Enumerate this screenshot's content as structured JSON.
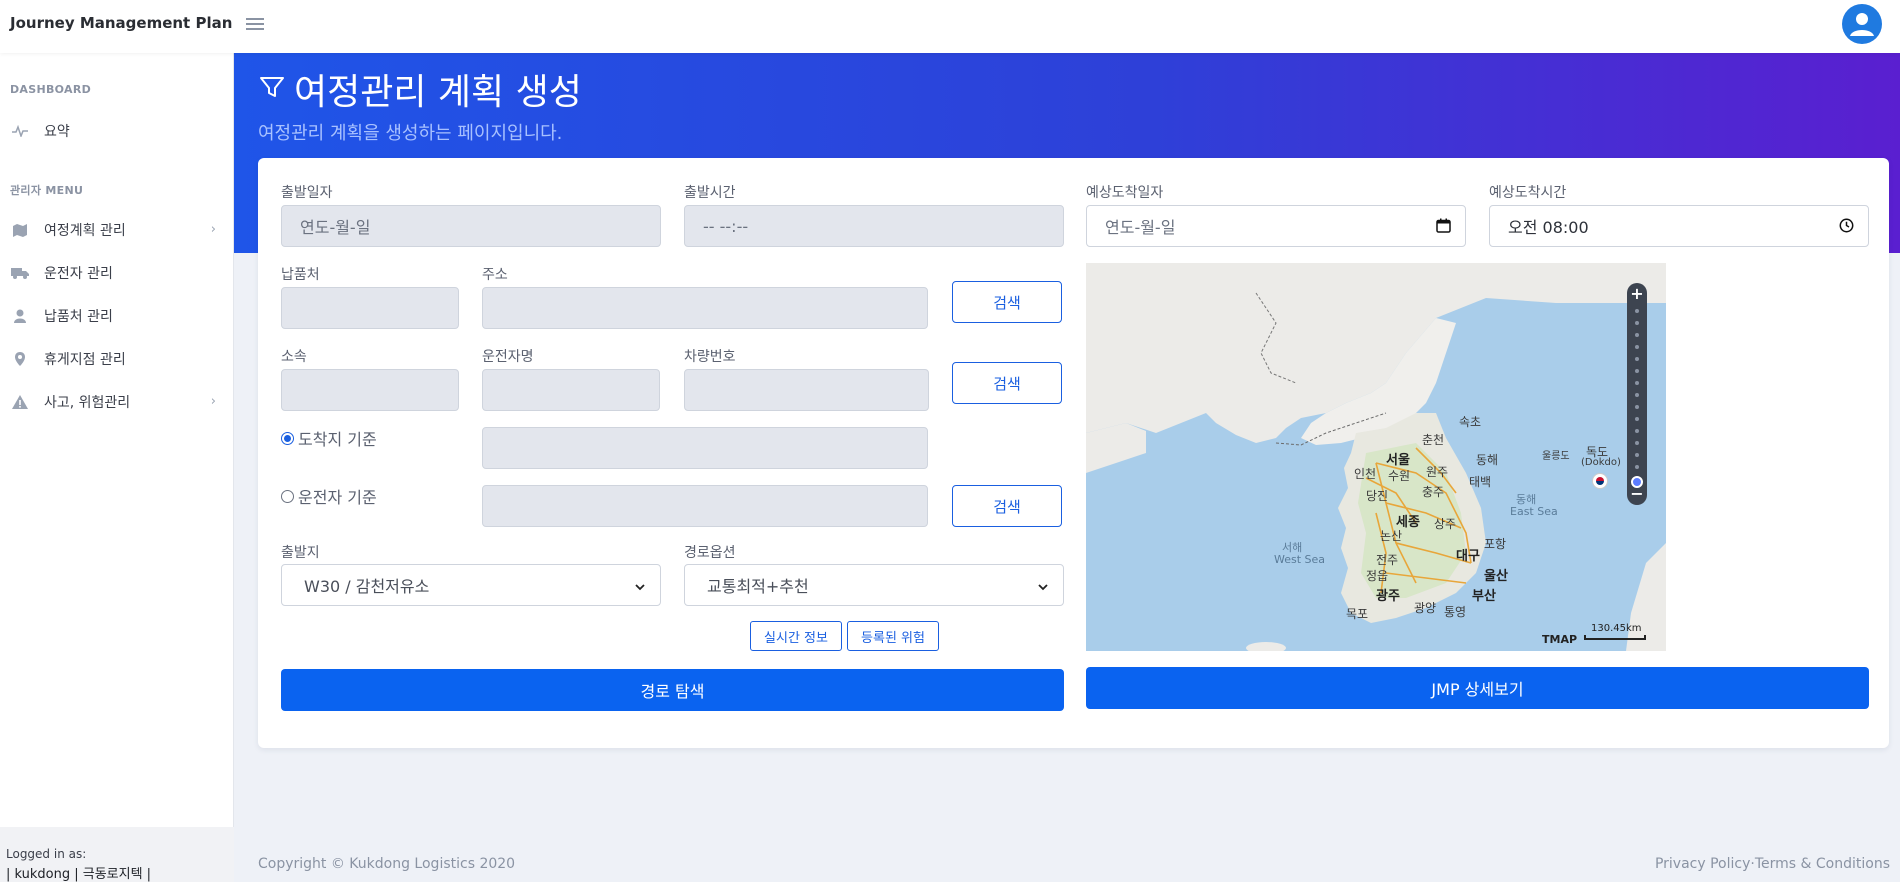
{
  "app": {
    "brand": "Journey Management Plan"
  },
  "sidebar": {
    "heading_dashboard": "DASHBOARD",
    "item_summary": "요약",
    "heading_admin": "관리자 MENU",
    "items": [
      {
        "label": "여정계획 관리",
        "icon": "map-marker-icon",
        "has_chevron": true
      },
      {
        "label": "운전자 관리",
        "icon": "truck-icon",
        "has_chevron": false
      },
      {
        "label": "납품처 관리",
        "icon": "user-icon",
        "has_chevron": false
      },
      {
        "label": "휴게지점 관리",
        "icon": "location-pin-icon",
        "has_chevron": false
      },
      {
        "label": "사고, 위험관리",
        "icon": "warning-icon",
        "has_chevron": true
      }
    ],
    "logged_in_label": "Logged in as:",
    "logged_in_user": "| kukdong | 극동로지텍 |"
  },
  "page": {
    "title": "여정관리 계획 생성",
    "subtitle": "여정관리 계획을 생성하는 페이지입니다."
  },
  "form": {
    "departure_date": {
      "label": "출발일자",
      "placeholder": "연도-월-일"
    },
    "departure_time": {
      "label": "출발시간",
      "placeholder": "-- --:--"
    },
    "arrival_date": {
      "label": "예상도착일자",
      "placeholder": "연도-월-일"
    },
    "arrival_time": {
      "label": "예상도착시간",
      "value": "오전 08:00"
    },
    "delivery": {
      "label": "납품처",
      "value": ""
    },
    "address": {
      "label": "주소",
      "value": ""
    },
    "search_label": "검색",
    "affiliation": {
      "label": "소속",
      "value": ""
    },
    "driver_name": {
      "label": "운전자명",
      "value": ""
    },
    "vehicle_no": {
      "label": "차량번호",
      "value": ""
    },
    "radio_destination": "도착지 기준",
    "radio_driver": "운전자 기준",
    "origin": {
      "label": "출발지",
      "selected": "W30 / 감천저유소"
    },
    "route_option": {
      "label": "경로옵션",
      "selected": "교통최적+추천"
    },
    "realtime_btn": "실시간 정보",
    "registered_risk_btn": "등록된 위험",
    "route_search_btn": "경로 탐색",
    "jmp_detail_btn": "JMP 상세보기"
  },
  "map": {
    "cities": [
      {
        "name": "속초",
        "size": "small"
      },
      {
        "name": "춘천",
        "size": "small"
      },
      {
        "name": "서울",
        "size": "big"
      },
      {
        "name": "인천",
        "size": "small"
      },
      {
        "name": "수원",
        "size": "small"
      },
      {
        "name": "원주",
        "size": "small"
      },
      {
        "name": "동해",
        "size": "small"
      },
      {
        "name": "태백",
        "size": "small"
      },
      {
        "name": "당진",
        "size": "small"
      },
      {
        "name": "충주",
        "size": "small"
      },
      {
        "name": "세종",
        "size": "big"
      },
      {
        "name": "상주",
        "size": "small"
      },
      {
        "name": "논산",
        "size": "small"
      },
      {
        "name": "전주",
        "size": "small"
      },
      {
        "name": "포항",
        "size": "small"
      },
      {
        "name": "대구",
        "size": "big"
      },
      {
        "name": "정읍",
        "size": "small"
      },
      {
        "name": "울산",
        "size": "big"
      },
      {
        "name": "광주",
        "size": "big"
      },
      {
        "name": "부산",
        "size": "big"
      },
      {
        "name": "광양",
        "size": "small"
      },
      {
        "name": "통영",
        "size": "small"
      },
      {
        "name": "목포",
        "size": "small"
      },
      {
        "name": "울릉도",
        "size": "small"
      },
      {
        "name": "독도",
        "size": "small"
      }
    ],
    "dokdo_sub": "(Dokdo)",
    "east_sea_ko": "동해",
    "east_sea_en": "East Sea",
    "west_sea_ko": "서해",
    "west_sea_en": "West Sea",
    "attribution": "TMAP",
    "scale": "130.45km",
    "zoom_in": "+",
    "zoom_out": "−"
  },
  "footer": {
    "copyright": "Copyright © Kukdong Logistics 2020",
    "privacy": "Privacy Policy",
    "sep": "·",
    "terms": "Terms & Conditions"
  },
  "colors": {
    "primary": "#0a63f0",
    "hero_start": "#1f55e8",
    "hero_end": "#5a1fd0"
  }
}
